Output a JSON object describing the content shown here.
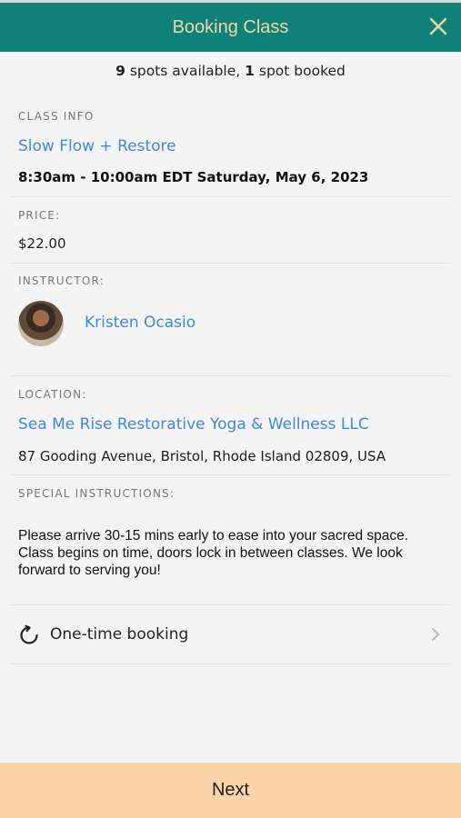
{
  "header": {
    "title": "Booking Class",
    "close_icon": "close-icon",
    "bg_color": "#0f8179",
    "title_color": "#ead9a6"
  },
  "availability": {
    "spots_available_count": "9",
    "spots_available_text": " spots available, ",
    "spots_booked_count": "1",
    "spots_booked_text": " spot booked"
  },
  "class_info": {
    "label": "CLASS INFO",
    "name": "Slow Flow + Restore",
    "datetime": "8:30am - 10:00am EDT Saturday, May 6, 2023"
  },
  "price": {
    "label": "PRICE:",
    "value": "$22.00"
  },
  "instructor": {
    "label": "INSTRUCTOR:",
    "name": "Kristen Ocasio",
    "avatar_icon": "instructor-avatar"
  },
  "location": {
    "label": "LOCATION:",
    "name": "Sea Me Rise Restorative Yoga & Wellness LLC",
    "address": "87 Gooding Avenue, Bristol, Rhode Island 02809, USA"
  },
  "special_instructions": {
    "label": "SPECIAL INSTRUCTIONS:",
    "line1": "Please arrive 30-15 mins early to ease into your sacred space.",
    "line2": "Class begins on time, doors lock in between classes. We look",
    "line3": "forward to serving you!"
  },
  "booking_option": {
    "label": "One-time booking",
    "icon": "refresh-icon",
    "chevron": "chevron-right-icon"
  },
  "footer": {
    "next_label": "Next",
    "bg_color": "#fcd4a9"
  },
  "colors": {
    "link": "#3f8ad6",
    "background": "#f4f4f4"
  }
}
